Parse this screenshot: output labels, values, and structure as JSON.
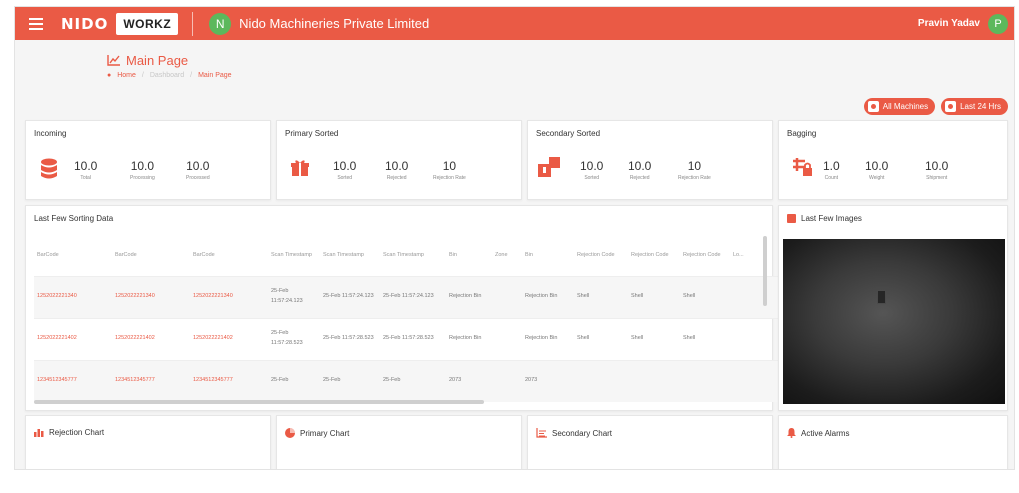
{
  "topbar": {
    "brand": "NIDO",
    "workz": "WORKZ",
    "company_initial": "N",
    "company_name": "Nido Machineries Private Limited",
    "user_name": "Pravin Yadav",
    "user_initial": "P"
  },
  "page": {
    "title": "Main Page",
    "breadcrumb": [
      "Home",
      "Dashboard",
      "Main Page"
    ]
  },
  "buttons": {
    "all_machines": "All Machines",
    "last_hrs": "Last 24 Hrs"
  },
  "incoming": {
    "title": "Incoming",
    "stats": [
      {
        "value": "10.0",
        "label": "Total"
      },
      {
        "value": "10.0",
        "label": "Processing"
      },
      {
        "value": "10.0",
        "label": "Processed"
      }
    ]
  },
  "primary_sorted": {
    "title": "Primary Sorted",
    "stats": [
      {
        "value": "10.0",
        "label": "Sorted"
      },
      {
        "value": "10.0",
        "label": "Rejected"
      },
      {
        "value": "10",
        "label": "Rejection Rate"
      }
    ]
  },
  "secondary_sorted": {
    "title": "Secondary Sorted",
    "stats": [
      {
        "value": "10.0",
        "label": "Sorted"
      },
      {
        "value": "10.0",
        "label": "Rejected"
      },
      {
        "value": "10",
        "label": "Rejection Rate"
      }
    ]
  },
  "bagging": {
    "title": "Bagging",
    "stats": [
      {
        "value": "1.0",
        "label": "Count"
      },
      {
        "value": "10.0",
        "label": "Weight"
      },
      {
        "value": "10.0",
        "label": "Shipment"
      }
    ]
  },
  "sorting_table": {
    "title": "Last Few Sorting Data",
    "headers": [
      "BarCode",
      "BarCode",
      "BarCode",
      "Scan Timestamp",
      "Scan Timestamp",
      "Scan Timestamp",
      "Bin",
      "Zone",
      "Bin",
      "Rejection Code",
      "Rejection Code",
      "Rejection Code",
      "Lo..."
    ],
    "rows": [
      [
        "1252022221340",
        "1252022221340",
        "1252022221340",
        "25-Feb 11:57:24.123",
        "25-Feb 11:57:24.123",
        "25-Feb 11:57:24.123",
        "Rejection Bin",
        "",
        "Rejection Bin",
        "Shell",
        "Shell",
        "Shell",
        ""
      ],
      [
        "1252022221402",
        "1252022221402",
        "1252022221402",
        "25-Feb 11:57:28.523",
        "25-Feb 11:57:28.523",
        "25-Feb 11:57:28.523",
        "Rejection Bin",
        "",
        "Rejection Bin",
        "Shell",
        "Shell",
        "Shell",
        ""
      ],
      [
        "1234512345777",
        "1234512345777",
        "1234512345777",
        "25-Feb",
        "25-Feb",
        "25-Feb",
        "2073",
        "",
        "2073",
        "",
        "",
        "",
        ""
      ]
    ]
  },
  "images": {
    "title": "Last Few Images"
  },
  "charts": {
    "rejection": "Rejection Chart",
    "primary": "Primary Chart",
    "secondary": "Secondary Chart",
    "alarms": "Active Alarms"
  },
  "colors": {
    "accent": "#ea5a45",
    "avatar": "#5cb85c"
  }
}
